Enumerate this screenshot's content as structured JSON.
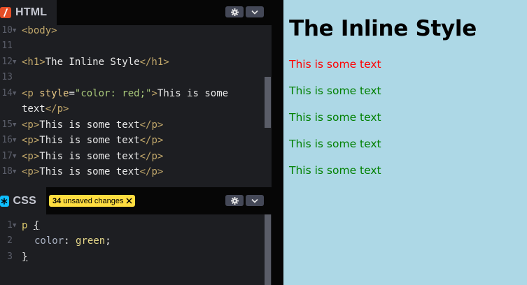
{
  "html_panel": {
    "tab_label": "HTML",
    "settings_icon": "gear-icon",
    "collapse_icon": "chevron-down-icon",
    "lines": [
      {
        "num": "10",
        "fold": true
      },
      {
        "num": "11",
        "fold": false
      },
      {
        "num": "12",
        "fold": true
      },
      {
        "num": "13",
        "fold": false
      },
      {
        "num": "14",
        "fold": true
      },
      {
        "num": "",
        "fold": false
      },
      {
        "num": "15",
        "fold": true
      },
      {
        "num": "16",
        "fold": true
      },
      {
        "num": "17",
        "fold": true
      },
      {
        "num": "18",
        "fold": true
      }
    ],
    "code": {
      "l10": "<body>",
      "l12_open": "<h1>",
      "l12_text": "The Inline Style",
      "l12_close": "</h1>",
      "l14_open": "<p ",
      "l14_attr": "style",
      "l14_eq": "=",
      "l14_str": "\"color: red;\"",
      "l14_gt": ">",
      "l14_text": "This is some",
      "l14b_text": "text",
      "l14b_close": "</p>",
      "p_open": "<p>",
      "p_text": "This is some text",
      "p_close": "</p>"
    }
  },
  "css_panel": {
    "tab_label": "CSS",
    "unsaved_count": "34",
    "unsaved_label": "unsaved changes",
    "lines": [
      {
        "num": "1",
        "fold": true
      },
      {
        "num": "2",
        "fold": false
      },
      {
        "num": "3",
        "fold": false
      }
    ],
    "code": {
      "selector": "p",
      "open_brace": "{",
      "property": "color",
      "colon": ":",
      "value": "green",
      "semicolon": ";",
      "close_brace": "}"
    }
  },
  "preview": {
    "heading": "The Inline Style",
    "paragraphs": [
      {
        "text": "This is some text",
        "color": "#ff0000"
      },
      {
        "text": "This is some text",
        "color": "#008000"
      },
      {
        "text": "This is some text",
        "color": "#008000"
      },
      {
        "text": "This is some text",
        "color": "#008000"
      },
      {
        "text": "This is some text",
        "color": "#008000"
      }
    ]
  },
  "colors": {
    "html_badge": "#e44d26",
    "css_badge": "#0ebeff",
    "unsaved_badge": "#ffdd40",
    "preview_bg": "#add8e6"
  }
}
